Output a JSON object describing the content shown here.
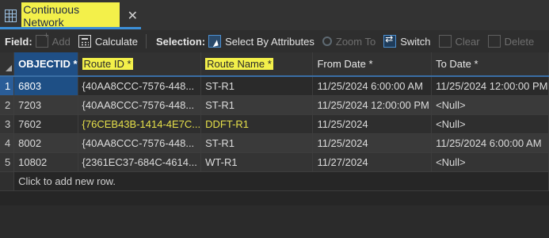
{
  "tab": {
    "title": "Continuous Network",
    "close": "✕"
  },
  "toolbar": {
    "field_label": "Field:",
    "add": "Add",
    "calculate": "Calculate",
    "selection_label": "Selection:",
    "select_by_attributes": "Select By Attributes",
    "zoom_to": "Zoom To",
    "switch": "Switch",
    "clear": "Clear",
    "delete": "Delete"
  },
  "table": {
    "columns": [
      "OBJECTID *",
      "Route ID *",
      "Route Name *",
      "From Date *",
      "To Date *"
    ],
    "rows": [
      {
        "num": "1",
        "oid": "6803",
        "route_id": "{40AA8CCC-7576-448...",
        "route_name": "ST-R1",
        "from": "11/25/2024 6:00:00 AM",
        "to": "11/25/2024 12:00:00 PM"
      },
      {
        "num": "2",
        "oid": "7203",
        "route_id": "{40AA8CCC-7576-448...",
        "route_name": "ST-R1",
        "from": "11/25/2024 12:00:00 PM",
        "to": "<Null>"
      },
      {
        "num": "3",
        "oid": "7602",
        "route_id": "{76CEB43B-1414-4E7C...",
        "route_name": "DDFT-R1",
        "from": "11/25/2024",
        "to": "<Null>"
      },
      {
        "num": "4",
        "oid": "8002",
        "route_id": "{40AA8CCC-7576-448...",
        "route_name": "ST-R1",
        "from": "11/25/2024",
        "to": "11/25/2024 6:00:00 AM"
      },
      {
        "num": "5",
        "oid": "10802",
        "route_id": "{2361EC37-684C-4614...",
        "route_name": "WT-R1",
        "from": "11/27/2024",
        "to": "<Null>"
      }
    ],
    "add_row_text": "Click to add new row."
  },
  "colors": {
    "accent": "#3c8fd8",
    "highlight": "#f3f04a",
    "selected": "#1e4f85"
  }
}
